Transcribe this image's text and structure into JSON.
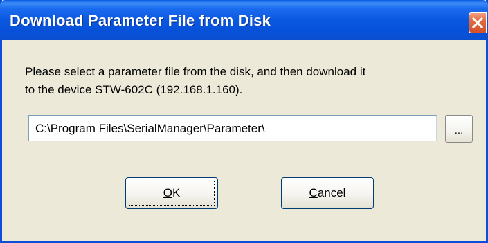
{
  "window": {
    "title": "Download Parameter File from Disk",
    "close_icon": "close-icon"
  },
  "message": {
    "line1": "Please select a parameter file from the disk, and then download it",
    "line2": "to the device  STW-602C (192.168.1.160)."
  },
  "path_input": {
    "value": "C:\\Program Files\\SerialManager\\Parameter\\"
  },
  "browse_button": {
    "label": "..."
  },
  "buttons": {
    "ok_label": "OK",
    "cancel_label": "Cancel"
  },
  "colors": {
    "titlebar": "#0a58e0",
    "close_button": "#e26a3f",
    "dialog_background": "#ece9d8"
  }
}
